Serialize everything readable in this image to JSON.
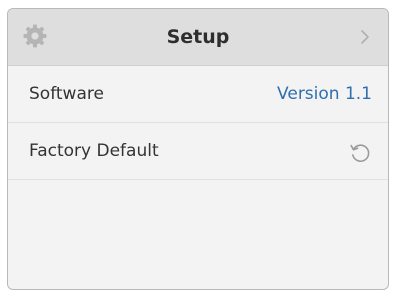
{
  "header": {
    "title": "Setup",
    "settings_icon": "gear-icon",
    "next_icon": "chevron-right-icon"
  },
  "rows": [
    {
      "label": "Software",
      "value": "Version 1.1"
    },
    {
      "label": "Factory Default",
      "action_icon": "reset-icon"
    }
  ],
  "colors": {
    "header_bg": "#dedede",
    "panel_bg": "#f3f3f3",
    "value_accent": "#2f6fb0"
  }
}
